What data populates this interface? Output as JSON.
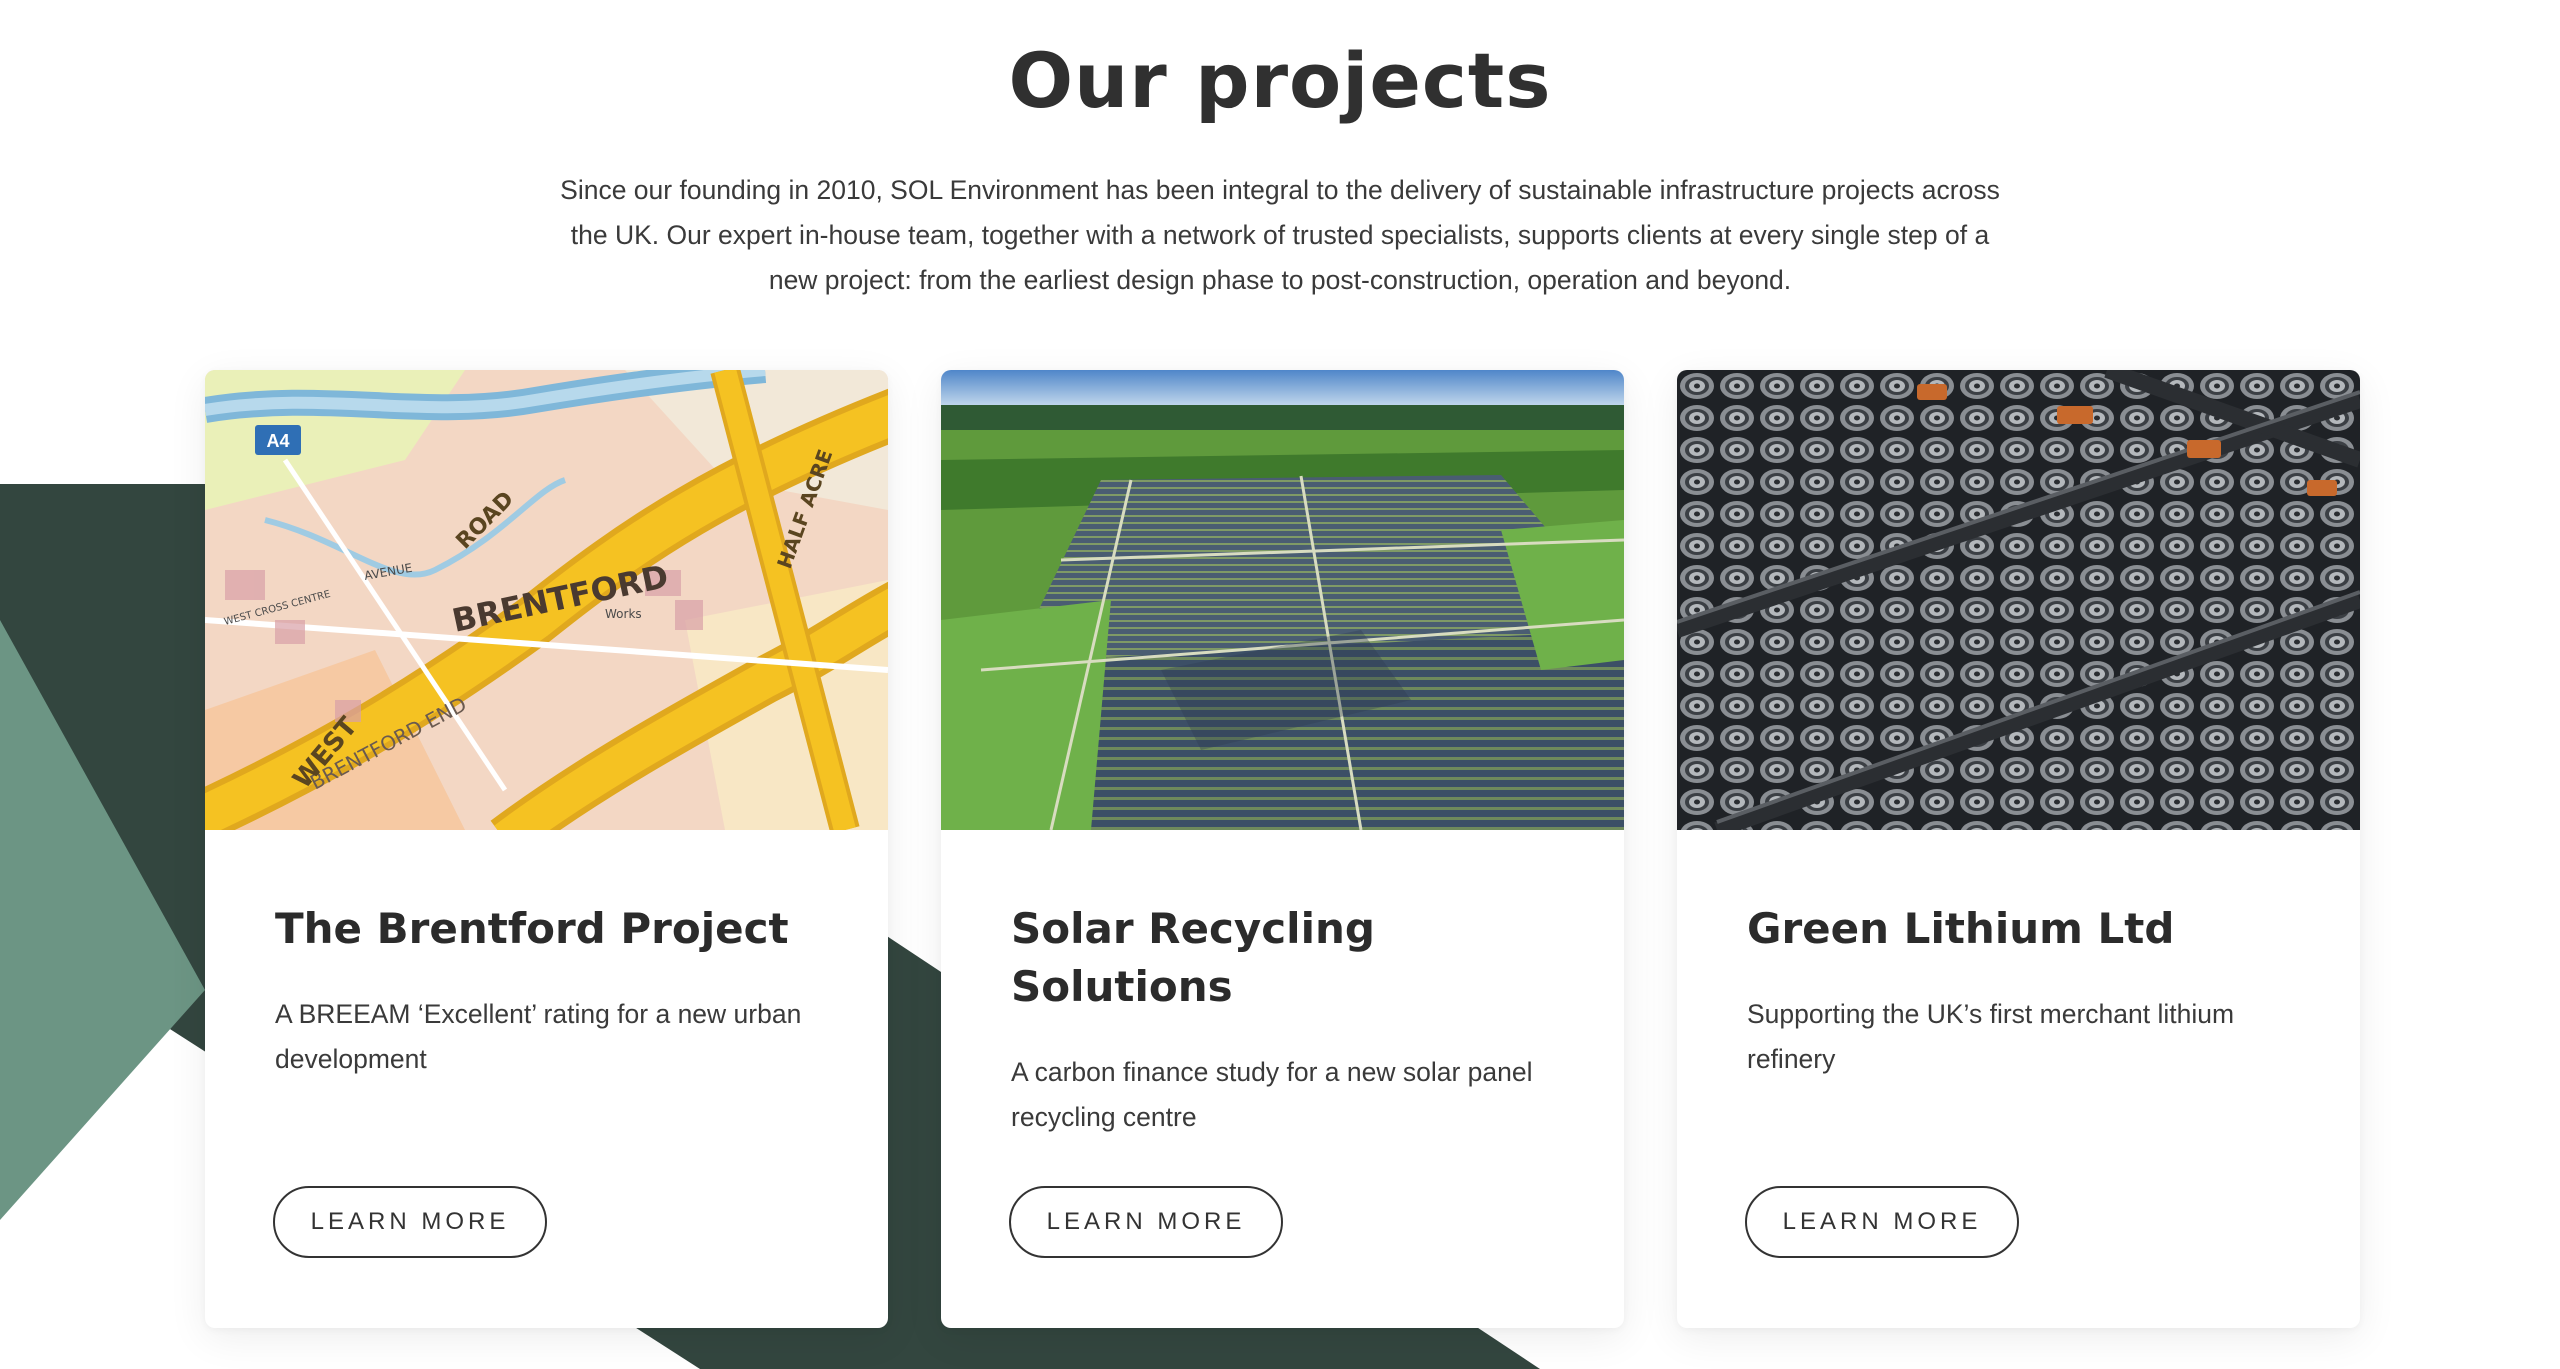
{
  "section": {
    "title": "Our projects",
    "intro": "Since our founding in 2010, SOL Environment has been integral to the delivery of sustainable infrastructure projects across the UK. Our expert in-house team, together with a network of trusted specialists, supports clients at every single step of a new project: from the earliest design phase to post-construction, operation and beyond."
  },
  "colors": {
    "dark_green": "#33463f",
    "sage_green": "#6c9584",
    "heading": "#303030"
  },
  "projects": [
    {
      "title": "The Brentford Project",
      "description": "A BREEAM ‘Excellent’ rating for a new urban development",
      "button_label": "LEARN MORE",
      "image": "street-map-brentford",
      "map_labels": {
        "area": "BRENTFORD",
        "end": "BRENTFORD END",
        "west": "WEST",
        "road": "ROAD",
        "halfacre": "HALF ACRE",
        "road_number": "A4",
        "small1": "WEST CROSS CENTRE",
        "small2": "Works",
        "small3": "AVENUE"
      }
    },
    {
      "title": "Solar Recycling Solutions",
      "description": "A carbon finance study for a new solar panel recycling centre",
      "button_label": "LEARN MORE",
      "image": "aerial-solar-farm"
    },
    {
      "title": "Green Lithium Ltd",
      "description": "Supporting the UK’s first merchant lithium refinery",
      "button_label": "LEARN MORE",
      "image": "battery-cells-closeup"
    }
  ]
}
